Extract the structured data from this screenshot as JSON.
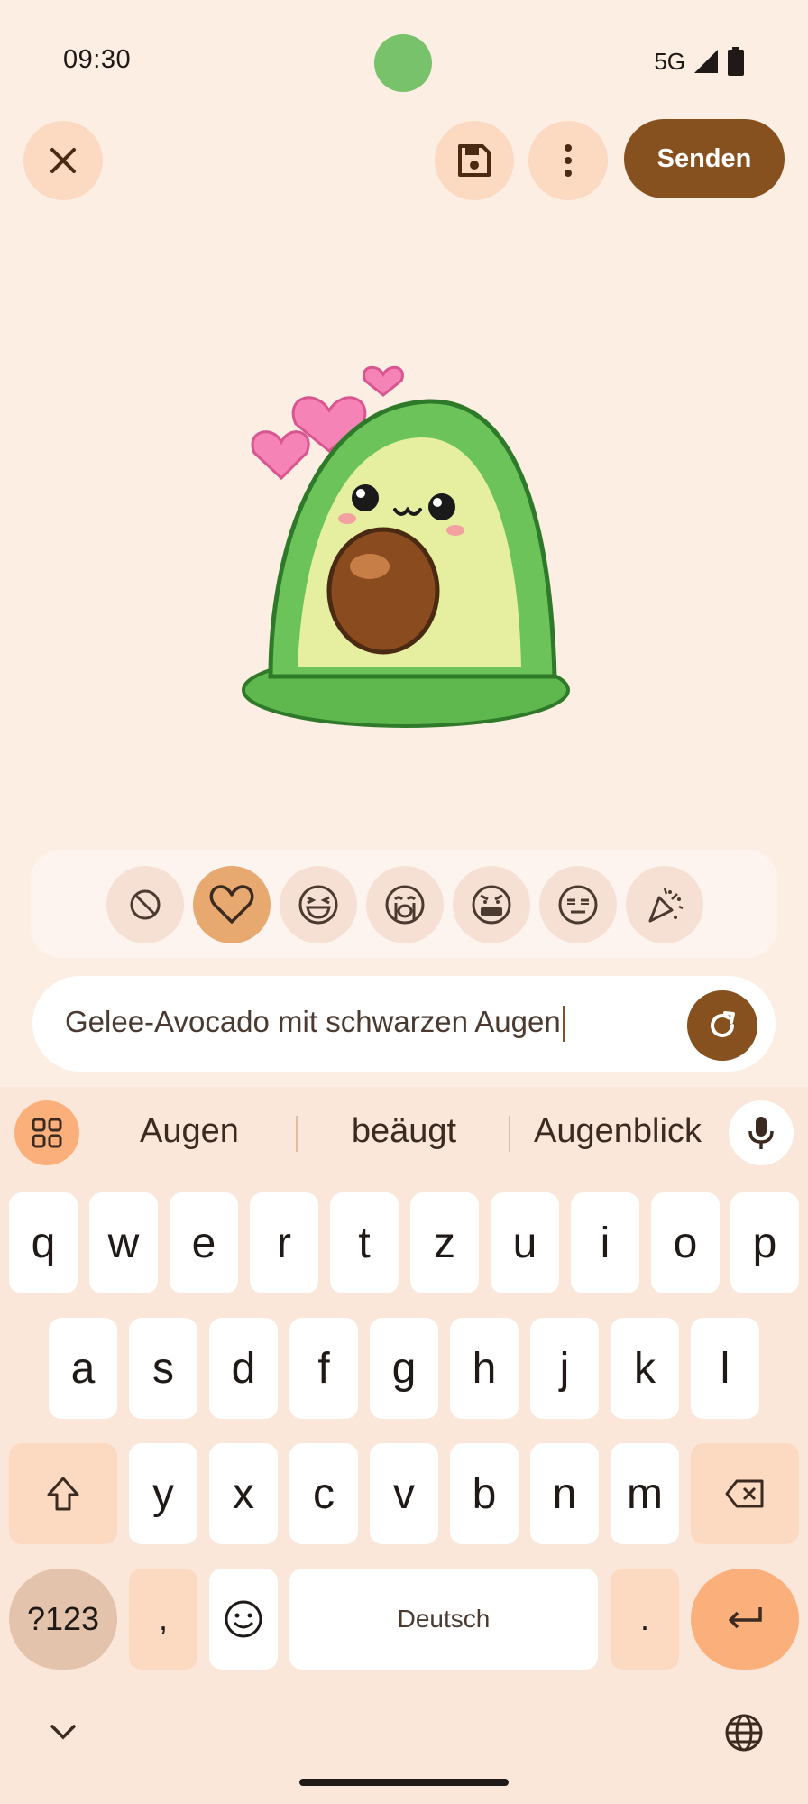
{
  "status_bar": {
    "time": "09:30",
    "network": "5G"
  },
  "toolbar": {
    "send_label": "Senden"
  },
  "emotions": [
    {
      "name": "none",
      "selected": false
    },
    {
      "name": "love",
      "selected": true
    },
    {
      "name": "laughing",
      "selected": false
    },
    {
      "name": "crying",
      "selected": false
    },
    {
      "name": "angry",
      "selected": false
    },
    {
      "name": "unamused",
      "selected": false
    },
    {
      "name": "party",
      "selected": false
    }
  ],
  "prompt": {
    "value": "Gelee-Avocado mit schwarzen Augen"
  },
  "keyboard": {
    "suggestions": [
      "Augen",
      "beäugt",
      "Augenblick"
    ],
    "row1": [
      "q",
      "w",
      "e",
      "r",
      "t",
      "z",
      "u",
      "i",
      "o",
      "p"
    ],
    "row2": [
      "a",
      "s",
      "d",
      "f",
      "g",
      "h",
      "j",
      "k",
      "l"
    ],
    "row3": [
      "y",
      "x",
      "c",
      "v",
      "b",
      "n",
      "m"
    ],
    "symbols_label": "?123",
    "comma": ",",
    "space_label": "Deutsch",
    "period": "."
  },
  "colors": {
    "background": "#fdeee4",
    "accent": "#86501f",
    "selected_emotion": "#e8a970",
    "key_special": "#fcd9c1",
    "enter": "#fbb07b"
  }
}
